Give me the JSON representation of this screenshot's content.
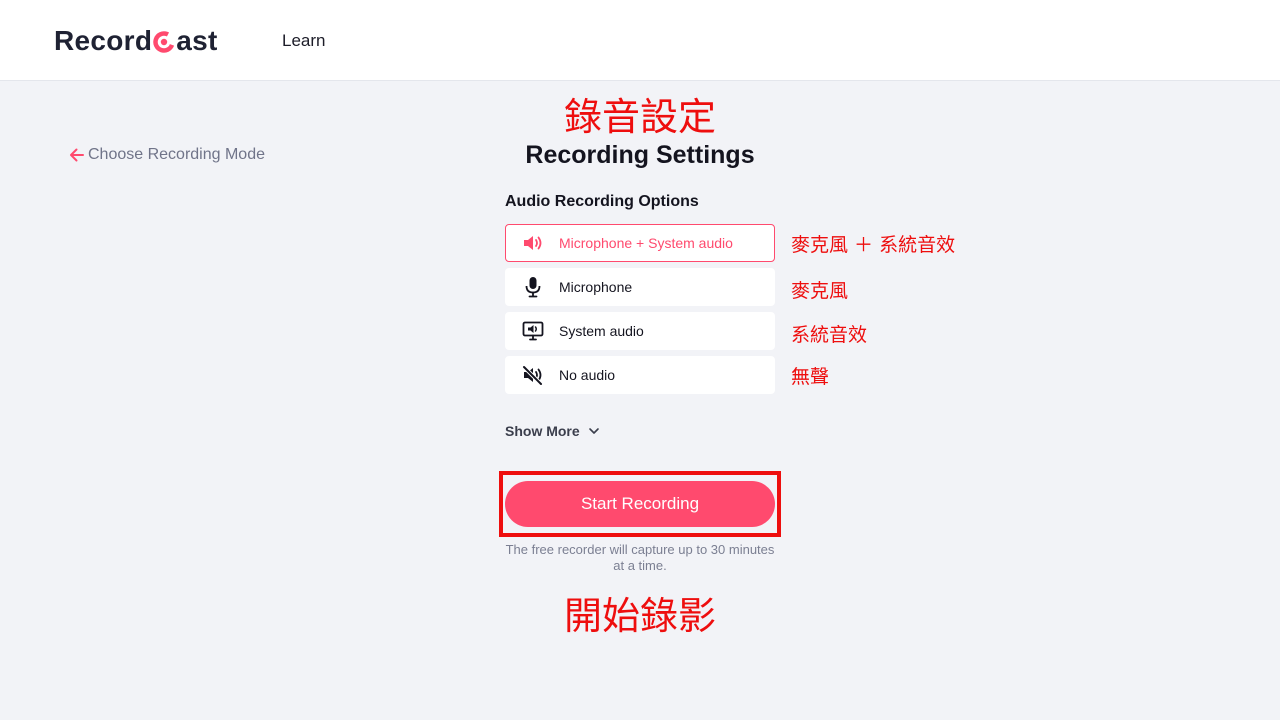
{
  "header": {
    "logo_left": "Record",
    "logo_right": "ast",
    "nav_learn": "Learn"
  },
  "annotations": {
    "title_zh": "錄音設定",
    "start_zh": "開始錄影",
    "options_zh": [
      "麥克風 ＋ 系統音效",
      "麥克風",
      "系統音效",
      "無聲"
    ]
  },
  "back_link": {
    "label": "Choose Recording Mode",
    "icon": "arrow-left-icon"
  },
  "page_title": "Recording Settings",
  "audio": {
    "section_label": "Audio Recording Options",
    "options": [
      {
        "label": "Microphone + System audio",
        "icon": "speaker-icon",
        "selected": true
      },
      {
        "label": "Microphone",
        "icon": "microphone-icon",
        "selected": false
      },
      {
        "label": "System audio",
        "icon": "monitor-speaker-icon",
        "selected": false
      },
      {
        "label": "No audio",
        "icon": "muted-speaker-icon",
        "selected": false
      }
    ],
    "show_more": "Show More"
  },
  "start_button": "Start Recording",
  "note": "The free recorder will capture up to 30 minutes at a time.",
  "colors": {
    "accent": "#ff4a6e",
    "annotation": "#ee0e0e",
    "background": "#f2f3f7"
  }
}
